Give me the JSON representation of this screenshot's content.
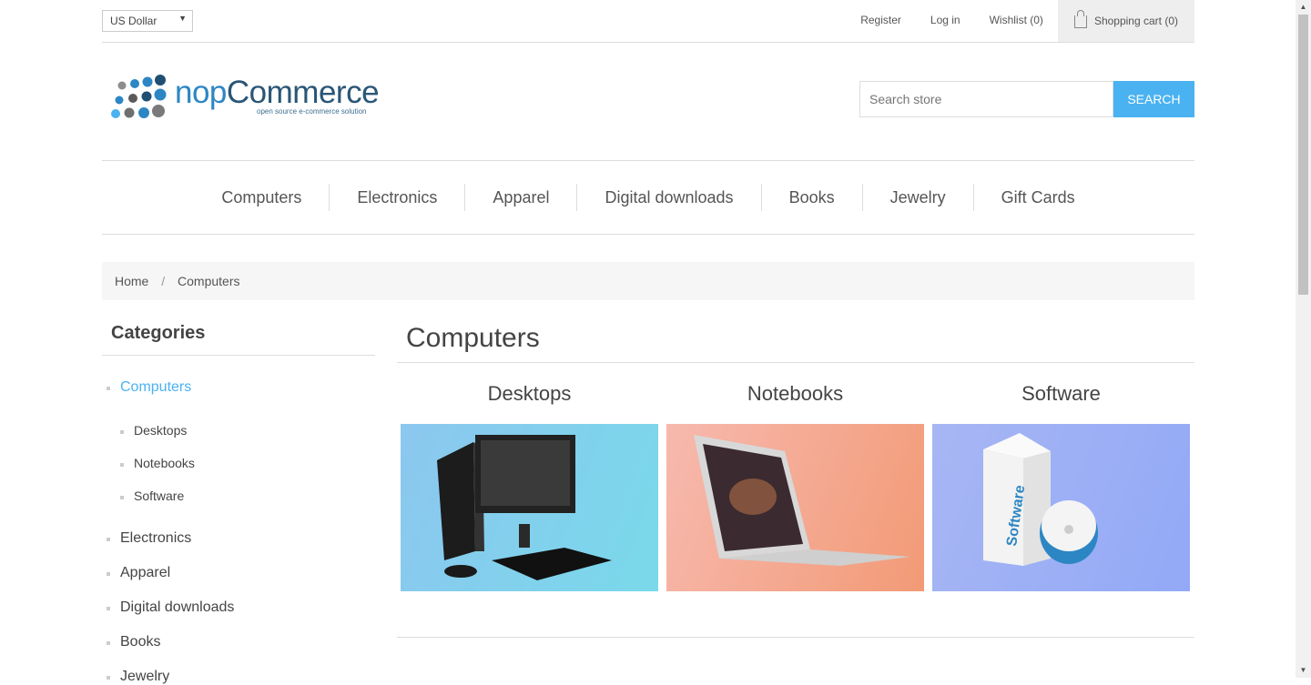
{
  "header": {
    "currency": "US Dollar",
    "links": [
      {
        "label": "Register"
      },
      {
        "label": "Log in"
      },
      {
        "label": "Wishlist (0)"
      }
    ],
    "cart_label": "Shopping cart (0)"
  },
  "logo": {
    "brand_nop": "nop",
    "brand_commerce": "Commerce",
    "tagline": "open source e-commerce solution"
  },
  "search": {
    "placeholder": "Search store",
    "button": "SEARCH"
  },
  "menu": [
    "Computers",
    "Electronics",
    "Apparel",
    "Digital downloads",
    "Books",
    "Jewelry",
    "Gift Cards"
  ],
  "breadcrumb": {
    "home": "Home",
    "sep": "/",
    "current": "Computers"
  },
  "sidebar": {
    "title": "Categories",
    "items": [
      "Computers",
      "Desktops",
      "Notebooks",
      "Software",
      "Electronics",
      "Apparel",
      "Digital downloads",
      "Books",
      "Jewelry"
    ]
  },
  "main": {
    "title": "Computers",
    "subcategories": [
      {
        "name": "Desktops"
      },
      {
        "name": "Notebooks"
      },
      {
        "name": "Software"
      }
    ]
  },
  "colors": {
    "accent": "#4ab2f1",
    "border": "#dddddd",
    "text": "#444444"
  },
  "icons": {
    "cart": "shopping-bag-icon",
    "dropdown": "chevron-down-icon"
  }
}
